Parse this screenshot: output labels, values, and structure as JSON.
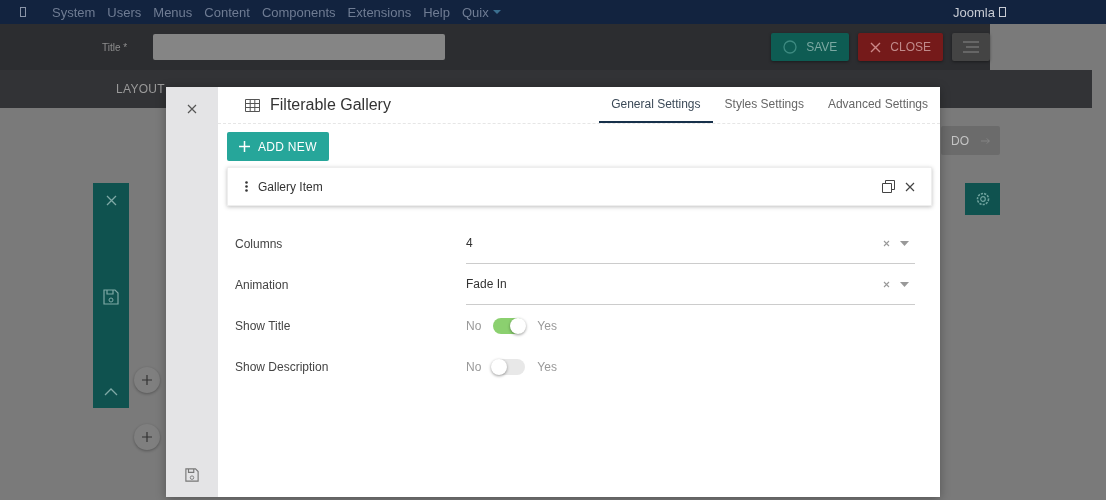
{
  "navbar": {
    "items": [
      "System",
      "Users",
      "Menus",
      "Content",
      "Components",
      "Extensions",
      "Help",
      "Quix"
    ],
    "user": "Joomla"
  },
  "toolbar": {
    "title_label": "Title *",
    "buttons": [
      {
        "kind": "save",
        "label": "SAVE"
      },
      {
        "kind": "close",
        "label": "CLOSE"
      },
      {
        "kind": "menu"
      }
    ]
  },
  "editor_tab": "LAYOUT",
  "redo_button": "DO",
  "modal": {
    "title": "Filterable Gallery",
    "tabs": [
      {
        "label": "General Settings",
        "selected": true
      },
      {
        "label": "Styles Settings",
        "selected": false
      },
      {
        "label": "Advanced Settings",
        "selected": false
      }
    ],
    "add_button": "ADD NEW",
    "items": [
      {
        "label": "Gallery Item"
      }
    ],
    "fields": [
      {
        "kind": "select",
        "label": "Columns",
        "value": "4"
      },
      {
        "kind": "select",
        "label": "Animation",
        "value": "Fade In"
      },
      {
        "kind": "toggle",
        "label": "Show Title",
        "off_label": "No",
        "on_label": "Yes",
        "on": true
      },
      {
        "kind": "toggle",
        "label": "Show Description",
        "off_label": "No",
        "on_label": "Yes",
        "on": false
      }
    ]
  }
}
